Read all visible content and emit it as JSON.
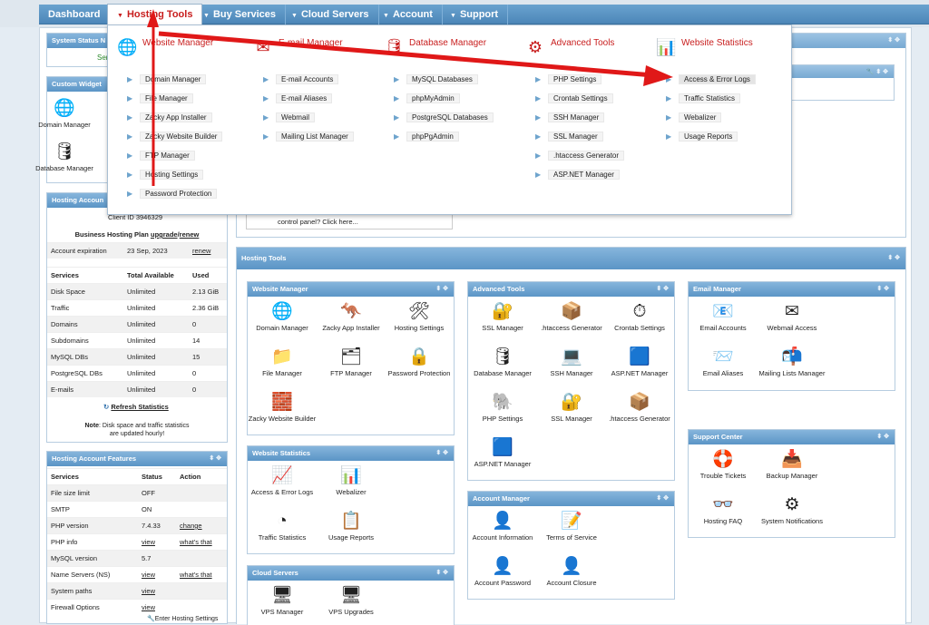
{
  "nav": {
    "dashboard": "Dashboard",
    "hosting_tools": "Hosting Tools",
    "buy_services": "Buy Services",
    "cloud_servers": "Cloud Servers",
    "account": "Account",
    "support": "Support"
  },
  "mega": {
    "website_manager": {
      "title": "Website Manager",
      "items": [
        "Domain Manager",
        "File Manager",
        "Zacky App Installer",
        "Zacky Website Builder",
        "FTP Manager",
        "Hosting Settings",
        "Password Protection"
      ]
    },
    "email_manager": {
      "title": "E-mail Manager",
      "items": [
        "E-mail Accounts",
        "E-mail Aliases",
        "Webmail",
        "Mailing List Manager"
      ]
    },
    "database_manager": {
      "title": "Database Manager",
      "items": [
        "MySQL Databases",
        "phpMyAdmin",
        "PostgreSQL Databases",
        "phpPgAdmin"
      ]
    },
    "advanced_tools": {
      "title": "Advanced Tools",
      "items": [
        "PHP Settings",
        "Crontab Settings",
        "SSH Manager",
        "SSL Manager",
        ".htaccess Generator",
        "ASP.NET Manager"
      ]
    },
    "website_statistics": {
      "title": "Website Statistics",
      "items": [
        "Access & Error Logs",
        "Traffic Statistics",
        "Webalizer",
        "Usage Reports"
      ]
    }
  },
  "left": {
    "system_status": {
      "title": "System Status N",
      "value": "Ser"
    },
    "custom_widget": {
      "title": "Custom Widget",
      "items": [
        "Domain Manager",
        "Database Manager"
      ]
    },
    "hosting_account": {
      "title": "Hosting Accoun",
      "client_id": "Client ID 3946329",
      "plan_pre": "Business Hosting Plan ",
      "upgrade": "upgrade",
      "sep": "/",
      "renew": "renew",
      "exp_label": "Account expiration",
      "exp_date": "23 Sep, 2023",
      "exp_renew": "renew",
      "headers": [
        "Services",
        "Total Available",
        "Used"
      ],
      "rows": [
        [
          "Disk Space",
          "Unlimited",
          "2.13 GiB"
        ],
        [
          "Traffic",
          "Unlimited",
          "2.36 GiB"
        ],
        [
          "Domains",
          "Unlimited",
          "0"
        ],
        [
          "Subdomains",
          "Unlimited",
          "14"
        ],
        [
          "MySQL DBs",
          "Unlimited",
          "15"
        ],
        [
          "PostgreSQL DBs",
          "Unlimited",
          "0"
        ],
        [
          "E-mails",
          "Unlimited",
          "0"
        ]
      ],
      "refresh": "Refresh Statistics",
      "note_b": "Note",
      "note": ": Disk space and traffic statistics",
      "note2": "are updated hourly!"
    },
    "features": {
      "title": "Hosting Account Features",
      "headers": [
        "Services",
        "Status",
        "Action"
      ],
      "rows": [
        [
          "File size limit",
          "OFF",
          ""
        ],
        [
          "SMTP",
          "ON",
          ""
        ],
        [
          "PHP version",
          "7.4.33",
          "change"
        ],
        [
          "PHP info",
          "view",
          "what's that"
        ],
        [
          "MySQL version",
          "5.7",
          ""
        ],
        [
          "Name Servers (NS)",
          "view",
          "what's that"
        ],
        [
          "System paths",
          "view",
          ""
        ],
        [
          "Firewall Options",
          "view",
          ""
        ]
      ],
      "enter": "Enter Hosting Settings"
    }
  },
  "promo": "control panel? Click here...",
  "hosting_tools": {
    "title": "Hosting Tools",
    "website_manager": {
      "title": "Website Manager",
      "items": [
        "Domain Manager",
        "Zacky App Installer",
        "Hosting Settings",
        "File Manager",
        "FTP Manager",
        "Password Protection",
        "Zacky Website Builder"
      ]
    },
    "advanced_tools": {
      "title": "Advanced Tools",
      "items": [
        "SSL Manager",
        ".htaccess Generator",
        "Crontab Settings",
        "Database Manager",
        "SSH Manager",
        "ASP.NET Manager",
        "PHP Settings",
        "SSL Manager",
        ".htaccess Generator",
        "ASP.NET Manager"
      ]
    },
    "email_manager": {
      "title": "Email Manager",
      "items": [
        "Email Accounts",
        "Webmail Access",
        "Email Aliases",
        "Mailing Lists Manager"
      ]
    },
    "website_statistics": {
      "title": "Website Statistics",
      "items": [
        "Access & Error Logs",
        "Webalizer",
        "Traffic Statistics",
        "Usage Reports"
      ]
    },
    "support_center": {
      "title": "Support Center",
      "items": [
        "Trouble Tickets",
        "Backup Manager",
        "Hosting FAQ",
        "System Notifications"
      ]
    },
    "account_manager": {
      "title": "Account Manager",
      "items": [
        "Account Information",
        "Terms of Service",
        "Account Password",
        "Account Closure"
      ]
    },
    "cloud_servers": {
      "title": "Cloud Servers",
      "items": [
        "VPS Manager",
        "VPS Upgrades"
      ]
    }
  },
  "colors": {
    "accent": "#c81e1e",
    "header": "#5b95c6",
    "arrow": "#e01818"
  }
}
